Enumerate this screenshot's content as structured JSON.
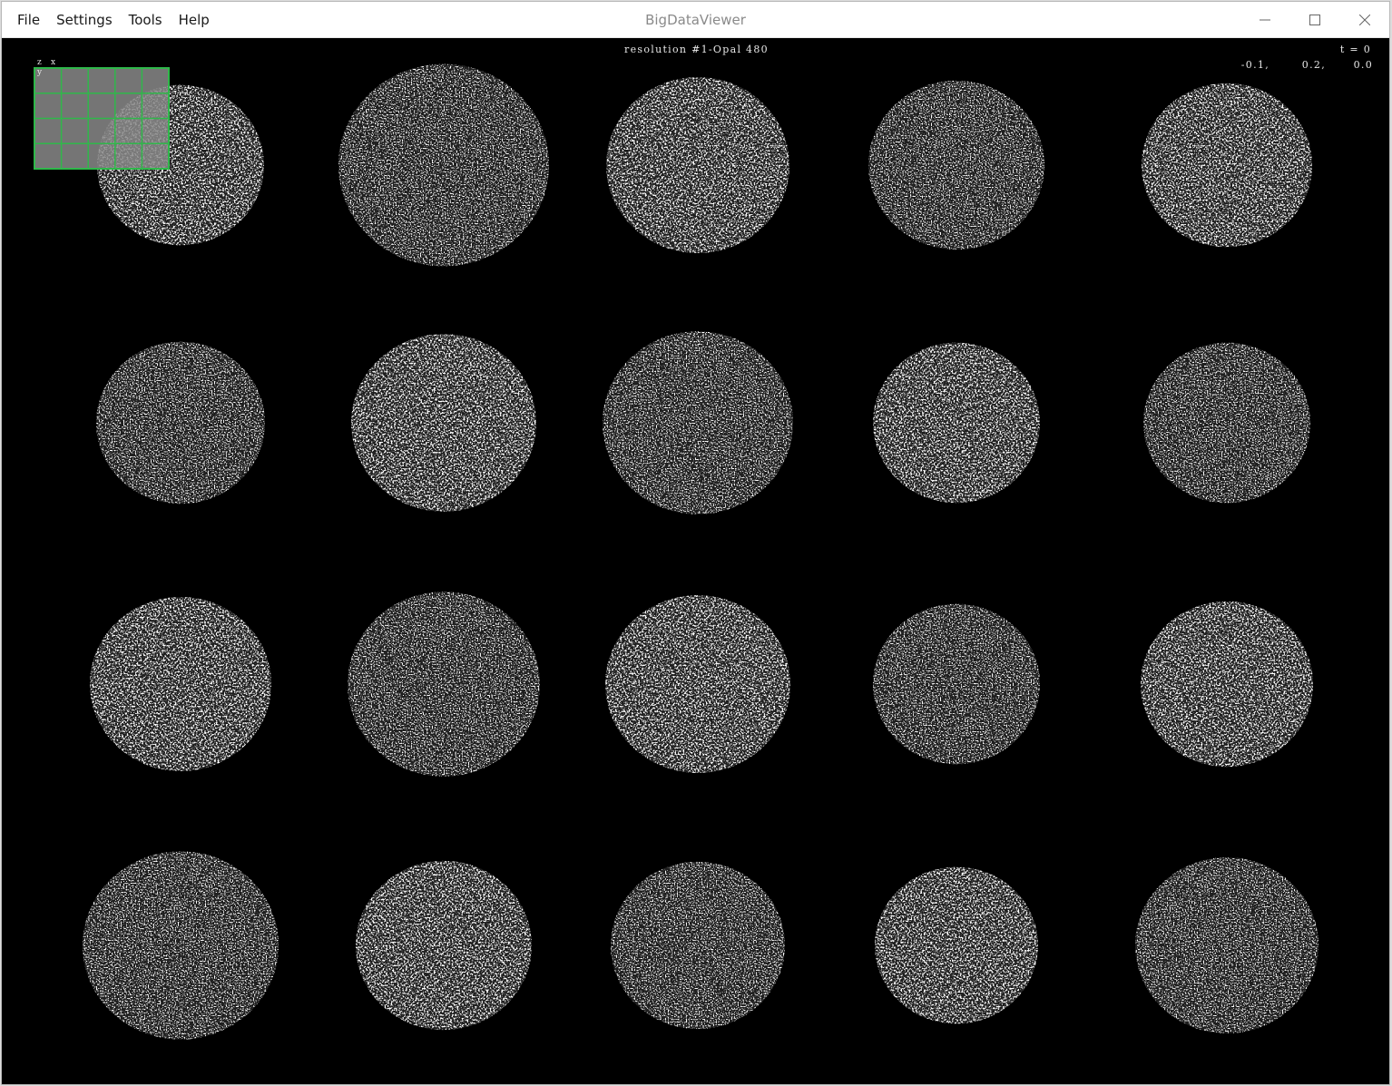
{
  "window": {
    "title": "BigDataViewer",
    "menu": [
      "File",
      "Settings",
      "Tools",
      "Help"
    ]
  },
  "viewer": {
    "resolution_label": "resolution #1-Opal 480",
    "time_label": "t = 0",
    "coordinates": [
      "-0.1,",
      "0.2,",
      "0.0"
    ],
    "axis_labels": {
      "z": "z",
      "x": "x",
      "y": "y"
    },
    "colors": {
      "background": "#000000",
      "overview_grid": "#2fb84a",
      "overview_fill": "#8a8a8a",
      "tissue": "#ffffff"
    },
    "overview": {
      "rows": 4,
      "cols": 5
    },
    "core_grid": {
      "rows": 4,
      "cols": 5,
      "count": 20
    }
  }
}
